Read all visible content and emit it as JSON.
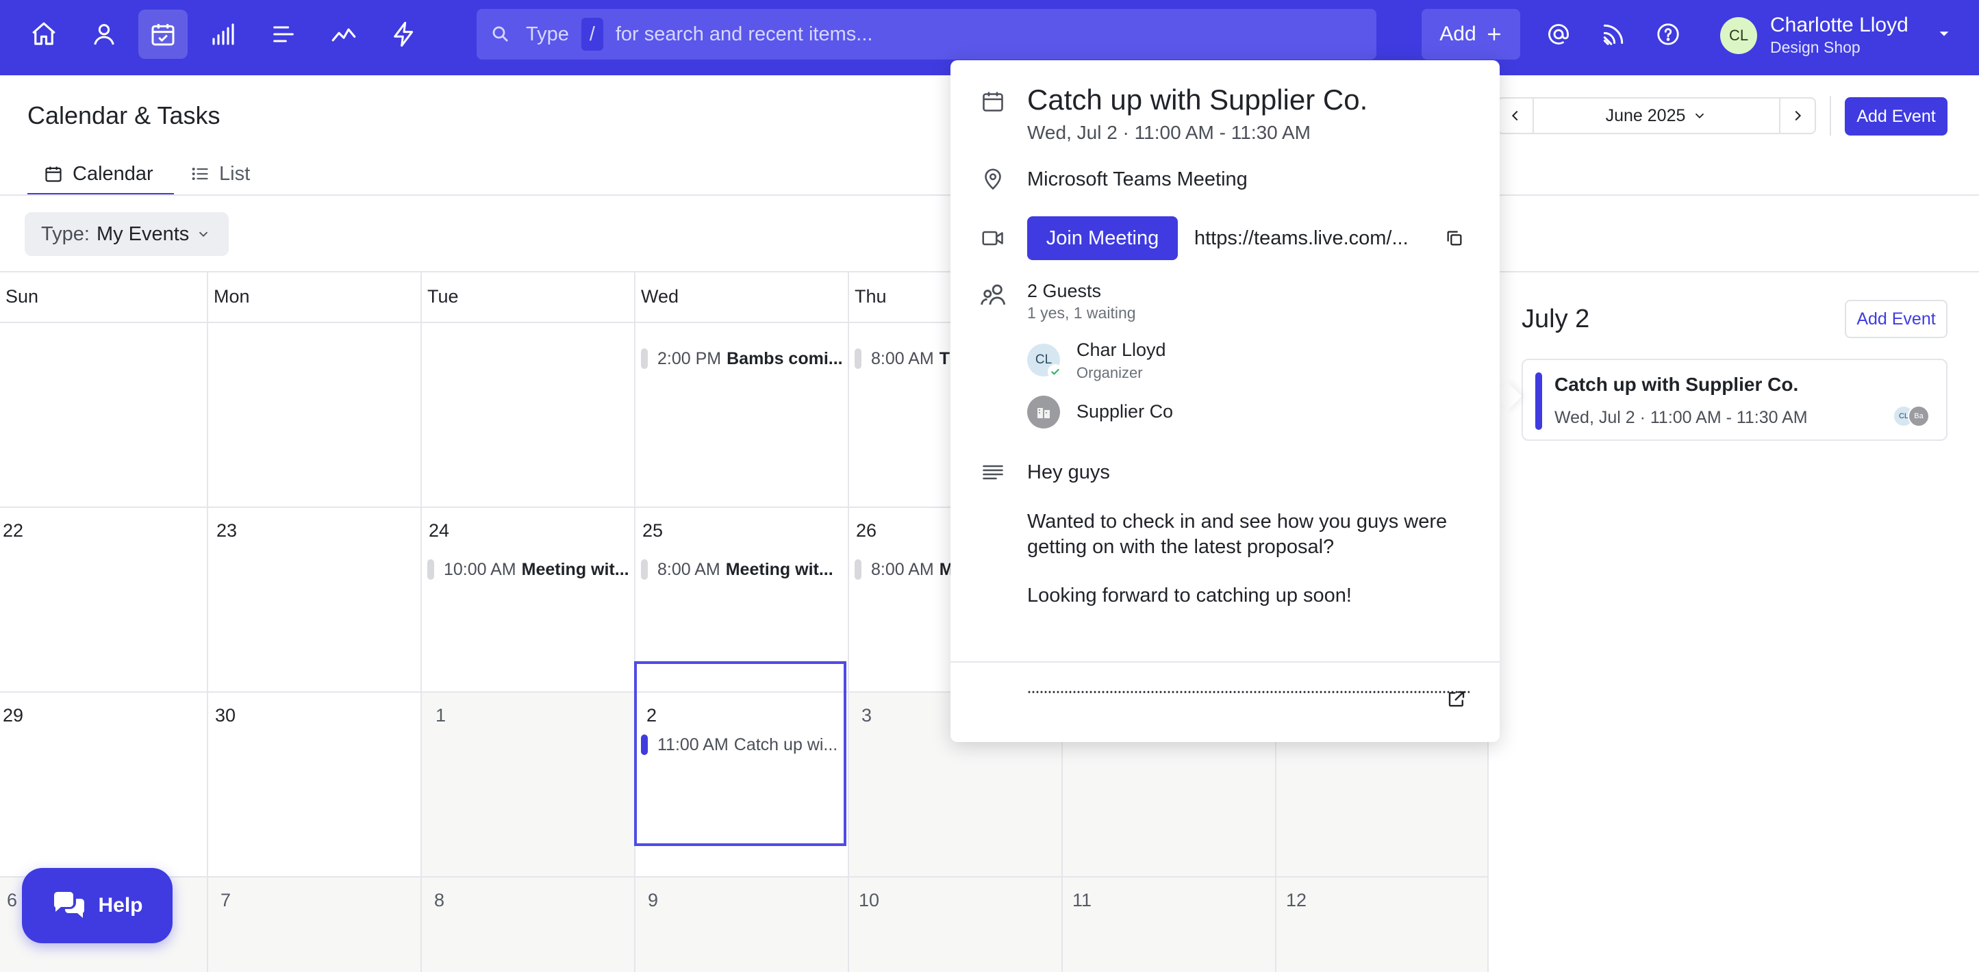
{
  "topbar": {
    "nav": [
      {
        "icon": "home-icon",
        "active": false
      },
      {
        "icon": "user-icon",
        "active": false
      },
      {
        "icon": "calendar-check-icon",
        "active": true
      },
      {
        "icon": "bar-chart-icon",
        "active": false
      },
      {
        "icon": "list-align-icon",
        "active": false
      },
      {
        "icon": "trend-line-icon",
        "active": false
      },
      {
        "icon": "lightning-icon",
        "active": false
      }
    ],
    "search": {
      "prefix": "Type",
      "key": "/",
      "suffix": "for search and recent items..."
    },
    "add_label": "Add",
    "user": {
      "initials": "CL",
      "name": "Charlotte Lloyd",
      "org": "Design Shop"
    }
  },
  "page": {
    "title": "Calendar & Tasks",
    "tabs": [
      {
        "label": "Calendar",
        "active": true
      },
      {
        "label": "List",
        "active": false
      }
    ],
    "filter": {
      "label": "Type:",
      "value": "My Events"
    },
    "month_label": "June 2025",
    "add_event_label": "Add Event"
  },
  "calendar": {
    "weekdays": [
      "Sun",
      "Mon",
      "Tue",
      "Wed",
      "Thu"
    ],
    "row1_events": {
      "wed": {
        "time": "2:00 PM",
        "title": "Bambs comi..."
      },
      "thu": {
        "time": "8:00 AM",
        "title": "T"
      }
    },
    "row2": {
      "days": [
        "22",
        "23",
        "24",
        "25",
        "26"
      ],
      "tue": {
        "time": "10:00 AM",
        "title": "Meeting wit..."
      },
      "wed": {
        "time": "8:00 AM",
        "title": "Meeting wit..."
      },
      "thu": {
        "time": "8:00 AM",
        "title": "M"
      }
    },
    "row3": {
      "days": [
        "29",
        "30",
        "1",
        "2",
        "3"
      ],
      "wed": {
        "time": "11:00 AM",
        "title": "Catch up wi..."
      }
    },
    "row4": {
      "days": [
        "6",
        "7",
        "8",
        "9",
        "10",
        "11",
        "12"
      ]
    }
  },
  "popover": {
    "title": "Catch up with Supplier Co.",
    "when": "Wed, Jul 2 · 11:00 AM - 11:30 AM",
    "location": "Microsoft Teams Meeting",
    "join_label": "Join Meeting",
    "url": "https://teams.live.com/...",
    "guests_title": "2 Guests",
    "guests_summary": "1 yes, 1 waiting",
    "guests": [
      {
        "initials": "CL",
        "name": "Char Lloyd",
        "role": "Organizer"
      },
      {
        "name": "Supplier Co"
      }
    ],
    "note": {
      "greeting": "Hey guys",
      "body": "Wanted to check in and see how you guys were getting on with the latest proposal?",
      "closing": "Looking forward to catching up soon!"
    }
  },
  "right_panel": {
    "date_label": "July 2",
    "add_event_label": "Add Event",
    "event": {
      "title": "Catch up with Supplier Co.",
      "when": "Wed, Jul 2 · 11:00 AM - 11:30 AM",
      "avatars": [
        "CL",
        "Ba"
      ]
    }
  },
  "help": {
    "label": "Help"
  },
  "colors": {
    "brand": "#3f3be0",
    "brand_light": "#5a57ea"
  }
}
